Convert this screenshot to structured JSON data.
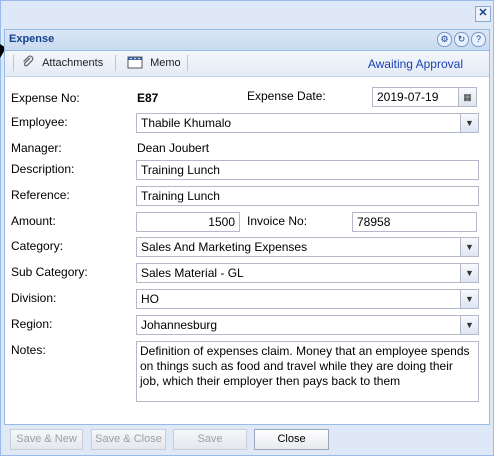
{
  "window": {
    "close_glyph": "✕"
  },
  "panel": {
    "title": "Expense",
    "tools": [
      "gear-icon",
      "refresh-icon",
      "help-icon"
    ]
  },
  "toolbar": {
    "attachments_label": "Attachments",
    "memo_label": "Memo",
    "status": "Awaiting Approval"
  },
  "form": {
    "expense_no_label": "Expense No:",
    "expense_no": "E87",
    "expense_date_label": "Expense Date:",
    "expense_date": "2019-07-19",
    "employee_label": "Employee:",
    "employee": "Thabile Khumalo",
    "manager_label": "Manager:",
    "manager": "Dean Joubert",
    "description_label": "Description:",
    "description": "Training Lunch",
    "reference_label": "Reference:",
    "reference": "Training Lunch",
    "amount_label": "Amount:",
    "amount": "1500",
    "invoice_no_label": "Invoice No:",
    "invoice_no": "78958",
    "category_label": "Category:",
    "category": "Sales And Marketing Expenses",
    "sub_category_label": "Sub Category:",
    "sub_category": "Sales Material - GL",
    "division_label": "Division:",
    "division": "HO",
    "region_label": "Region:",
    "region": "Johannesburg",
    "notes_label": "Notes:",
    "notes": "Definition of expenses claim. Money that an employee spends on things such as food and travel while they are doing their job, which their employer then pays back to them"
  },
  "footer": {
    "save_new": "Save & New",
    "save_close": "Save & Close",
    "save": "Save",
    "close": "Close"
  }
}
